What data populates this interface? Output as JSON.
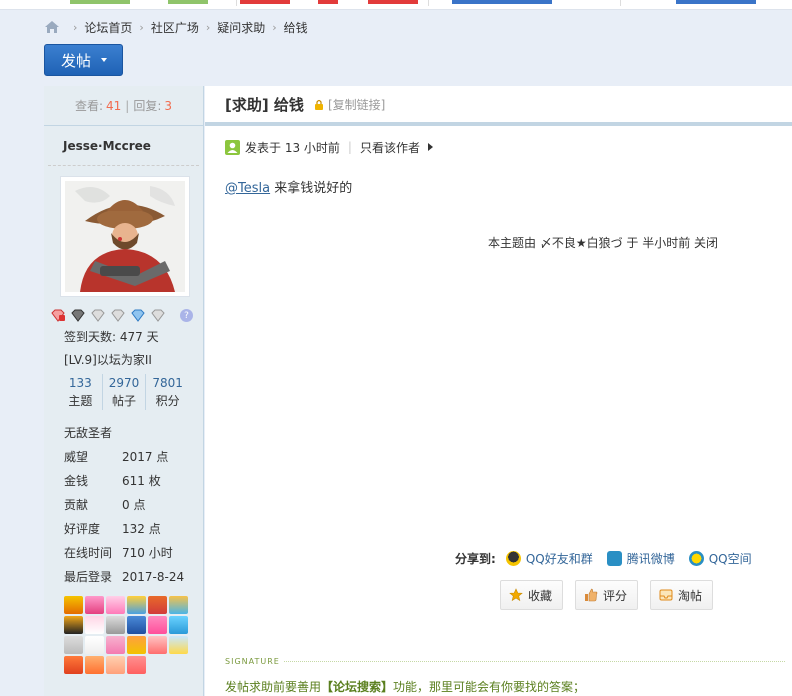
{
  "breadcrumb": {
    "items": [
      "论坛首页",
      "社区广场",
      "疑问求助",
      "给钱"
    ]
  },
  "post_button": {
    "label": "发帖"
  },
  "stats": {
    "views_label": "查看:",
    "views": "41",
    "sep": "|",
    "replies_label": "回复:",
    "replies": "3"
  },
  "author": {
    "name": "Jesse·Mccree",
    "checkin": "签到天数: 477 天",
    "level": "[LV.9]以坛为家II",
    "counts": [
      {
        "value": "133",
        "label": "主题"
      },
      {
        "value": "2970",
        "label": "帖子"
      },
      {
        "value": "7801",
        "label": "积分"
      }
    ],
    "rank": "无敌圣者",
    "fields": [
      {
        "k": "威望",
        "v": "2017 点"
      },
      {
        "k": "金钱",
        "v": "611 枚"
      },
      {
        "k": "贡献",
        "v": "0 点"
      },
      {
        "k": "好评度",
        "v": "132 点"
      },
      {
        "k": "在线时间",
        "v": "710 小时"
      },
      {
        "k": "最后登录",
        "v": "2017-8-24"
      }
    ]
  },
  "thread": {
    "title": "[求助] 给钱",
    "copy_link": "[复制链接]",
    "posted": "发表于 13 小时前",
    "only_author": "只看该作者",
    "mention": "@Tesla",
    "body": " 来拿钱说好的",
    "closed_note": "本主题由 〆不良★白狼づ 于 半小时前 关闭"
  },
  "share": {
    "label": "分享到:",
    "items": [
      "QQ好友和群",
      "腾讯微博",
      "QQ空间"
    ]
  },
  "actions": [
    "收藏",
    "评分",
    "淘帖"
  ],
  "signature": {
    "label": "SIGNATURE",
    "text_prefix": "发帖求助前要善用",
    "text_bold": "【论坛搜索】",
    "text_suffix": "功能，那里可能会有你要找的答案；"
  },
  "colors": {
    "accent_blue": "#1f62b5",
    "link": "#336699",
    "count_red": "#f26c4f",
    "sidebar_bg": "#e5edf2",
    "signature_green": "#5a7f1e"
  }
}
